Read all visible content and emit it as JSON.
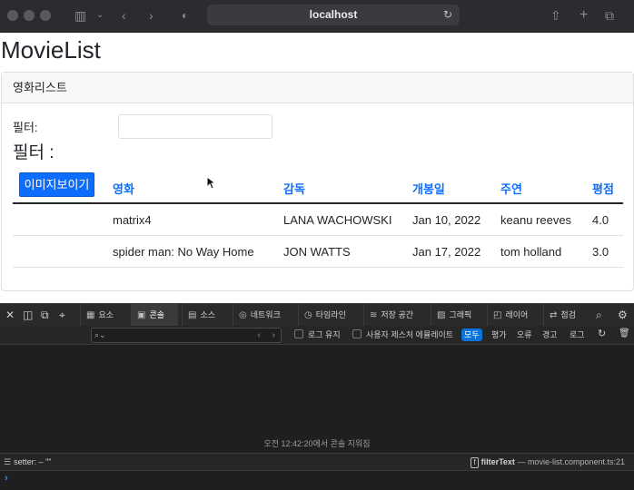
{
  "browser": {
    "url": "localhost",
    "icons": [
      "traffic-light-close",
      "traffic-light-minimize",
      "traffic-light-zoom",
      "sidebar-icon",
      "chevron-down-icon",
      "back-icon",
      "forward-icon",
      "shield-icon",
      "reload-icon",
      "share-icon",
      "new-tab-icon",
      "tab-overview-icon"
    ]
  },
  "page": {
    "title": "MovieList",
    "card_header": "영화리스트",
    "filter_label": "필터:",
    "filter_value": "",
    "filter_heading": "필터 :",
    "show_images_button": "이미지보이기",
    "columns": [
      "영화",
      "감독",
      "개봉일",
      "주연",
      "평점"
    ],
    "rows": [
      {
        "title": "matrix4",
        "director": "LANA WACHOWSKI",
        "release": "Jan 10, 2022",
        "star": "keanu reeves",
        "rating": "4.0"
      },
      {
        "title": "spider man: No Way Home",
        "director": "JON WATTS",
        "release": "Jan 17, 2022",
        "star": "tom holland",
        "rating": "3.0"
      }
    ],
    "accent_color": "#0d6efd"
  },
  "devtools": {
    "tabs": [
      "요소",
      "콘솔",
      "소스",
      "네트워크",
      "타임라인",
      "저장 공간",
      "그래픽",
      "레이어",
      "점검"
    ],
    "active_tab": "콘솔",
    "options": [
      "로그 유지",
      "사용자 제스처 에뮬레이트"
    ],
    "levels": [
      "모두",
      "평가",
      "오류",
      "경고",
      "로그"
    ],
    "active_level": "모두",
    "cleared_message": "오전 12:42:20에서 콘솔 지워짐",
    "status_left": "setter: – \"\"",
    "status_function": "filterText",
    "status_source": " — movie-list.component.ts:21"
  }
}
